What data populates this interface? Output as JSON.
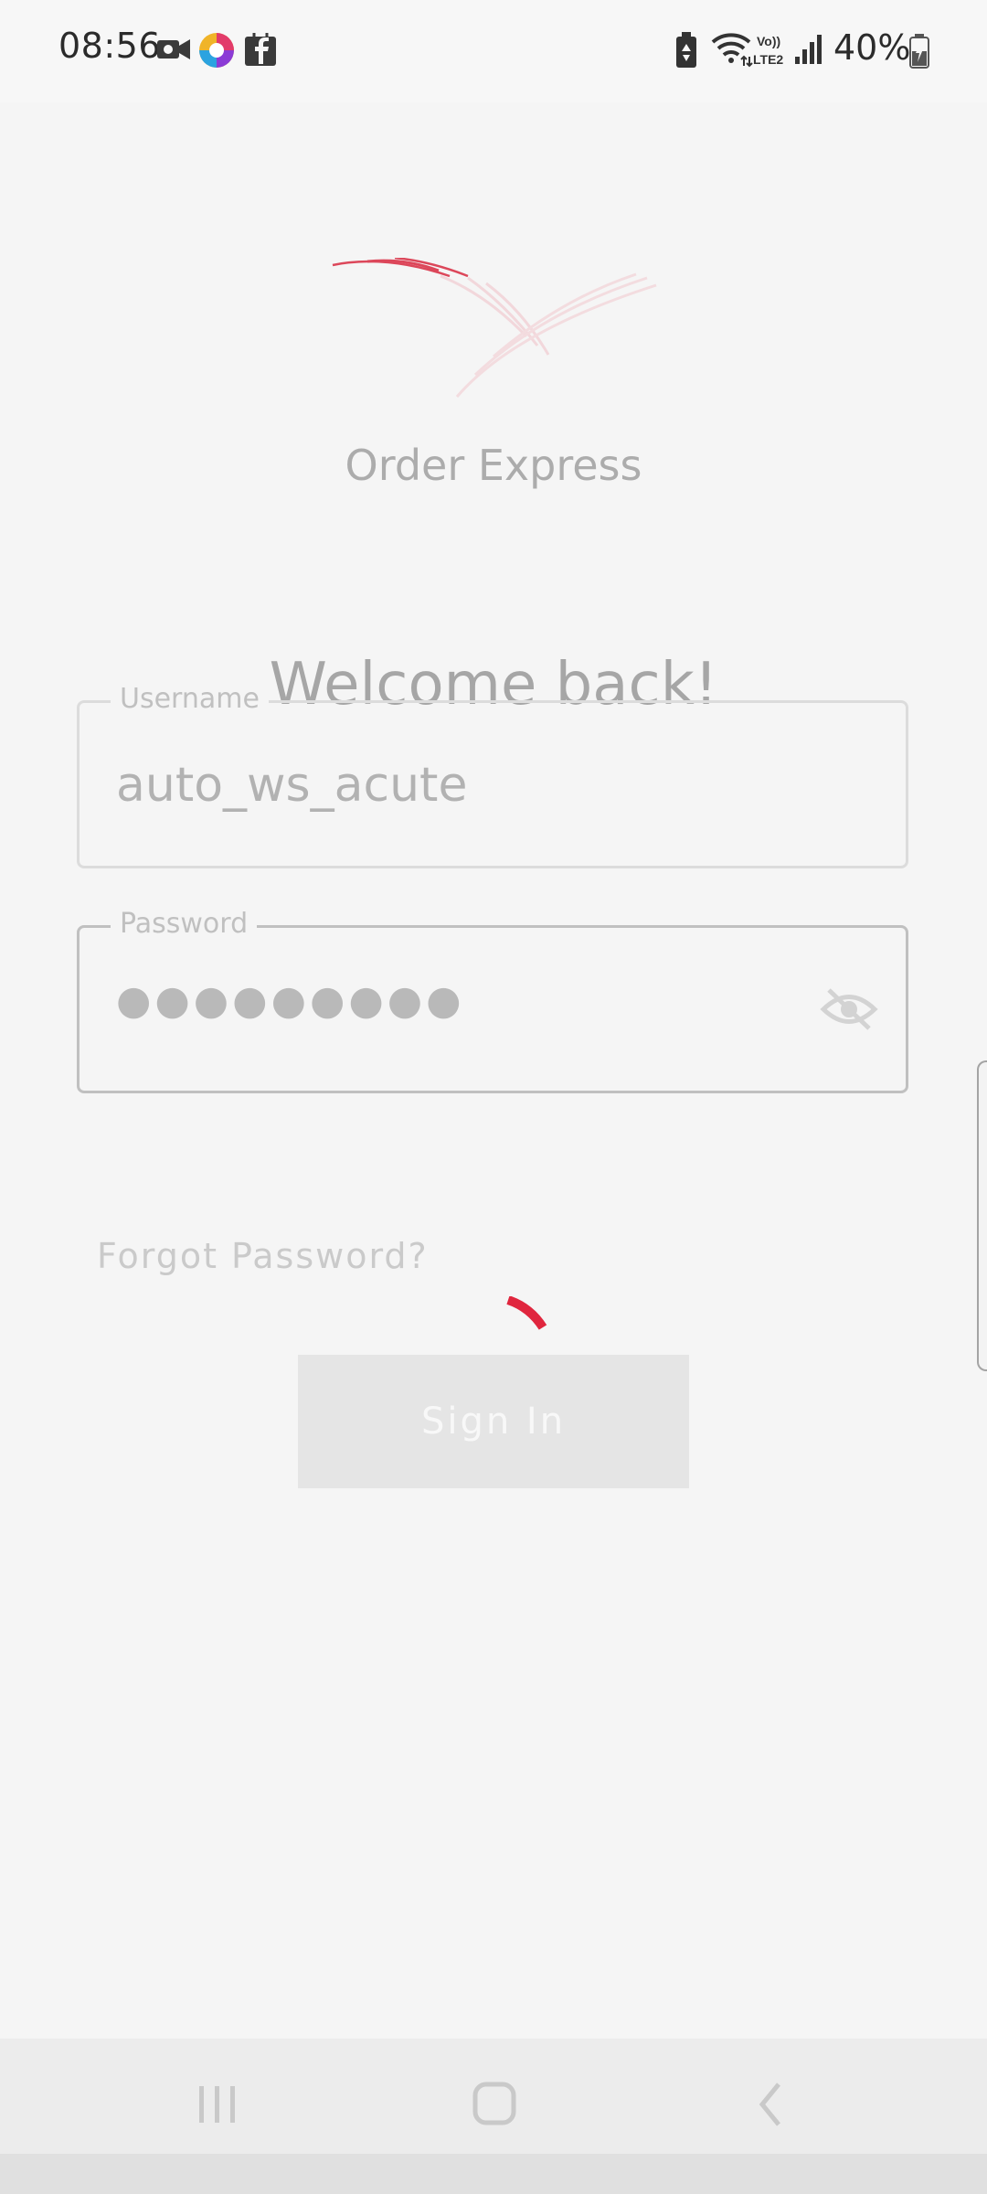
{
  "status_bar": {
    "time": "08:56",
    "battery_percent": "40%",
    "notification_icons": [
      "video-call-icon",
      "browser-app-icon",
      "facebook-icon"
    ],
    "system_icons": [
      "battery-saver-icon",
      "wifi-icon",
      "volte-lte2-icon",
      "signal-icon",
      "battery-icon"
    ]
  },
  "app": {
    "name": "Order Express",
    "brand_color": "#e0263e"
  },
  "login": {
    "welcome": "Welcome back!",
    "username_label": "Username",
    "username_value": "auto_ws_acute",
    "password_label": "Password",
    "password_masked": "●●●●●●●●●",
    "forgot_password": "Forgot Password?",
    "sign_in": "Sign In"
  },
  "state": {
    "loading": true
  },
  "nav_bar": {
    "buttons": [
      "recent-apps-icon",
      "home-icon",
      "back-icon"
    ]
  }
}
